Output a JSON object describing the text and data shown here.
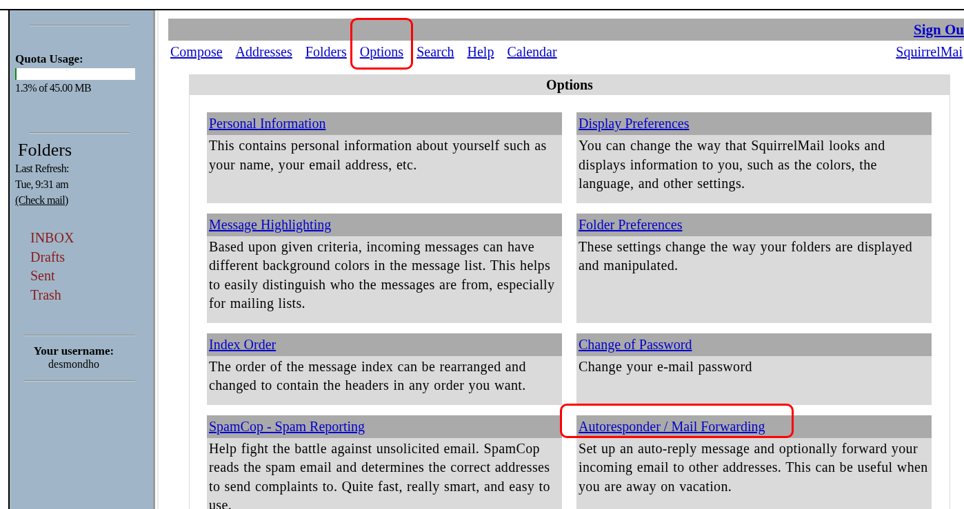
{
  "sidebar": {
    "quota": {
      "label": "Quota Usage:",
      "level": 0.013,
      "text": "1.3% of 45.00 MB"
    },
    "folders_title": "Folders",
    "last_refresh_label": "Last Refresh:",
    "last_refresh_time": "Tue, 9:31 am",
    "check_mail": "(Check mail)",
    "folders": [
      {
        "name": "INBOX"
      },
      {
        "name": "Drafts"
      },
      {
        "name": "Sent"
      },
      {
        "name": "Trash"
      }
    ],
    "username_label": "Your username:",
    "username": "desmondho"
  },
  "top_bar": {
    "sign_out": "Sign Ou"
  },
  "nav": [
    {
      "label": "Compose",
      "highlighted": false
    },
    {
      "label": "Addresses",
      "highlighted": false
    },
    {
      "label": "Folders",
      "highlighted": false
    },
    {
      "label": "Options",
      "highlighted": true
    },
    {
      "label": "Search",
      "highlighted": false
    },
    {
      "label": "Help",
      "highlighted": false
    },
    {
      "label": "Calendar",
      "highlighted": false
    }
  ],
  "brand_link": "SquirrelMai",
  "options": {
    "title": "Options",
    "items": [
      {
        "title": "Personal Information",
        "description": "This contains personal information about yourself such as your name, your email address, etc.",
        "highlighted": false
      },
      {
        "title": "Display Preferences",
        "description": "You can change the way that SquirrelMail looks and displays information to you, such as the colors, the language, and other settings.",
        "highlighted": false
      },
      {
        "title": "Message Highlighting",
        "description": "Based upon given criteria, incoming messages can have different background colors in the message list. This helps to easily distinguish who the messages are from, especially for mailing lists.",
        "highlighted": false
      },
      {
        "title": "Folder Preferences",
        "description": "These settings change the way your folders are displayed and manipulated.",
        "highlighted": false
      },
      {
        "title": "Index Order",
        "description": "The order of the message index can be rearranged and changed to contain the headers in any order you want.",
        "highlighted": false
      },
      {
        "title": "Change of Password",
        "description": "Change your e-mail password",
        "highlighted": false
      },
      {
        "title": "SpamCop - Spam Reporting",
        "description": "Help fight the battle against unsolicited email. SpamCop reads the spam email and determines the correct addresses to send complaints to. Quite fast, really smart, and easy to use.",
        "highlighted": false
      },
      {
        "title": "Autoresponder / Mail Forwarding",
        "description": "Set up an auto-reply message and optionally forward your incoming email to other addresses. This can be useful when you are away on vacation.",
        "highlighted": true
      }
    ]
  }
}
